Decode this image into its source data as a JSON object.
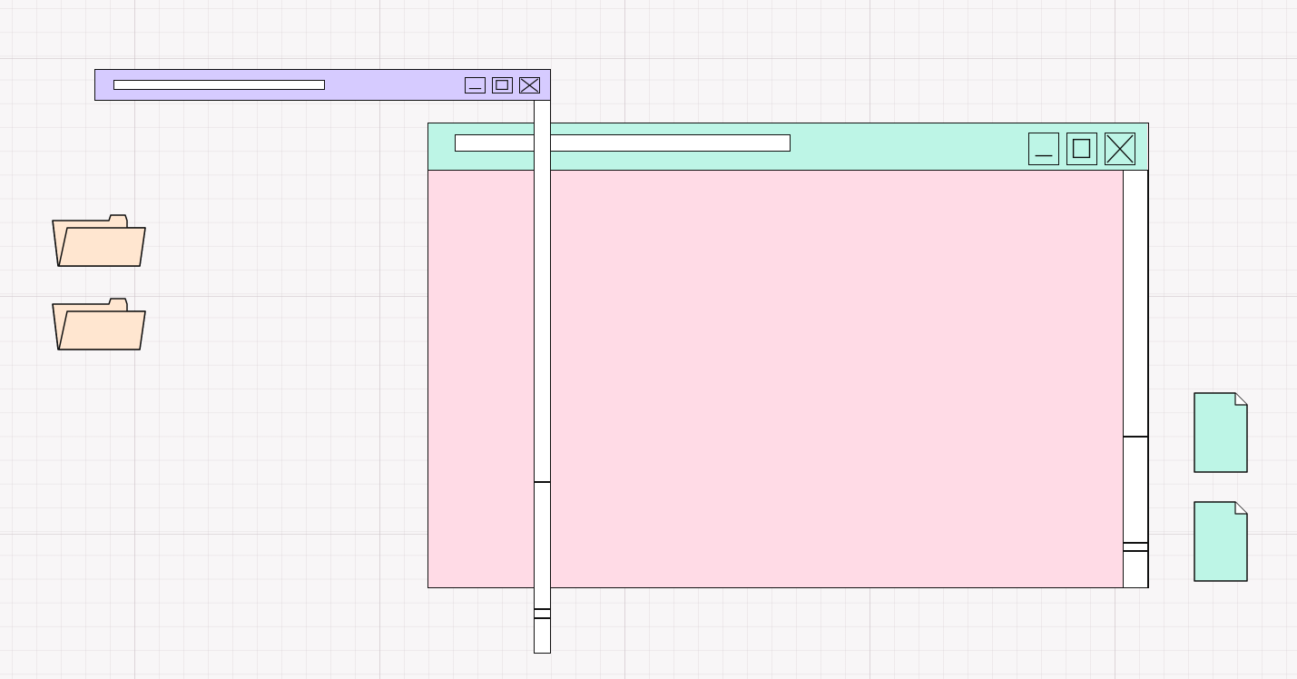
{
  "colors": {
    "small_window_titlebar": "#d6cbff",
    "large_window_titlebar": "#bdf5e6",
    "large_window_body": "#ffdbe6",
    "folder_fill": "#ffe6d0",
    "file_fill": "#bdf5e6",
    "outline": "#111111"
  },
  "small_window": {
    "title": "",
    "controls": {
      "minimize": "minimize-icon",
      "maximize": "maximize-icon",
      "close": "close-icon"
    }
  },
  "large_window": {
    "title": "",
    "controls": {
      "minimize": "minimize-icon",
      "maximize": "maximize-icon",
      "close": "close-icon"
    }
  },
  "desktop": {
    "folders": [
      {
        "icon": "folder-icon",
        "label": ""
      },
      {
        "icon": "folder-icon",
        "label": ""
      }
    ],
    "files": [
      {
        "icon": "file-icon",
        "label": ""
      },
      {
        "icon": "file-icon",
        "label": ""
      }
    ]
  }
}
